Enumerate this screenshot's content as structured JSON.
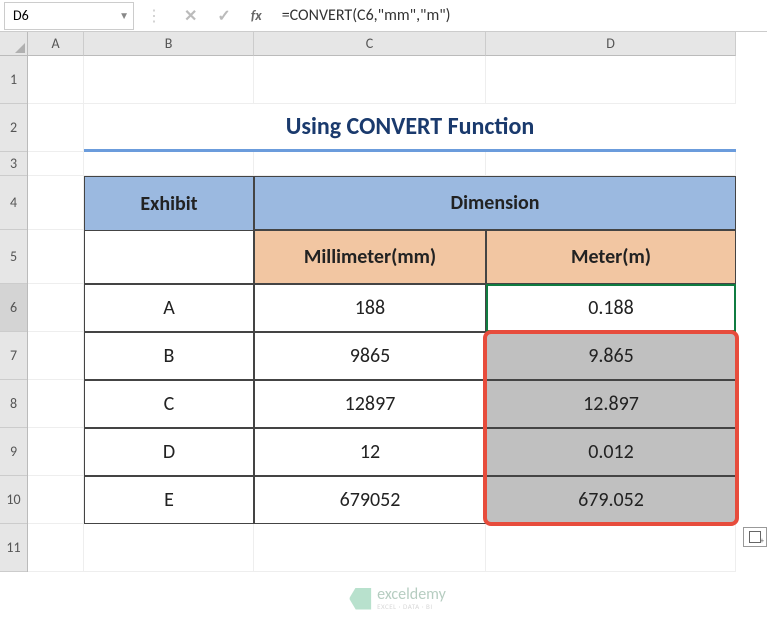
{
  "name_box": "D6",
  "formula": "=CONVERT(C6,\"mm\",\"m\")",
  "columns": [
    "A",
    "B",
    "C",
    "D"
  ],
  "row_numbers": [
    1,
    2,
    3,
    4,
    5,
    6,
    7,
    8,
    9,
    10,
    11
  ],
  "title": "Using CONVERT Function",
  "headers": {
    "exhibit": "Exhibit",
    "dimension": "Dimension",
    "mm": "Millimeter(mm)",
    "m": "Meter(m)"
  },
  "table": [
    {
      "exhibit": "A",
      "mm": "188",
      "m": "0.188"
    },
    {
      "exhibit": "B",
      "mm": "9865",
      "m": "9.865"
    },
    {
      "exhibit": "C",
      "mm": "12897",
      "m": "12.897"
    },
    {
      "exhibit": "D",
      "mm": "12",
      "m": "0.012"
    },
    {
      "exhibit": "E",
      "mm": "679052",
      "m": "679.052"
    }
  ],
  "watermark": {
    "main": "exceldemy",
    "sub": "EXCEL · DATA · BI"
  },
  "chart_data": {
    "type": "table",
    "title": "Using CONVERT Function",
    "columns": [
      "Exhibit",
      "Millimeter(mm)",
      "Meter(m)"
    ],
    "rows": [
      [
        "A",
        188,
        0.188
      ],
      [
        "B",
        9865,
        9.865
      ],
      [
        "C",
        12897,
        12.897
      ],
      [
        "D",
        12,
        0.012
      ],
      [
        "E",
        679052,
        679.052
      ]
    ]
  }
}
